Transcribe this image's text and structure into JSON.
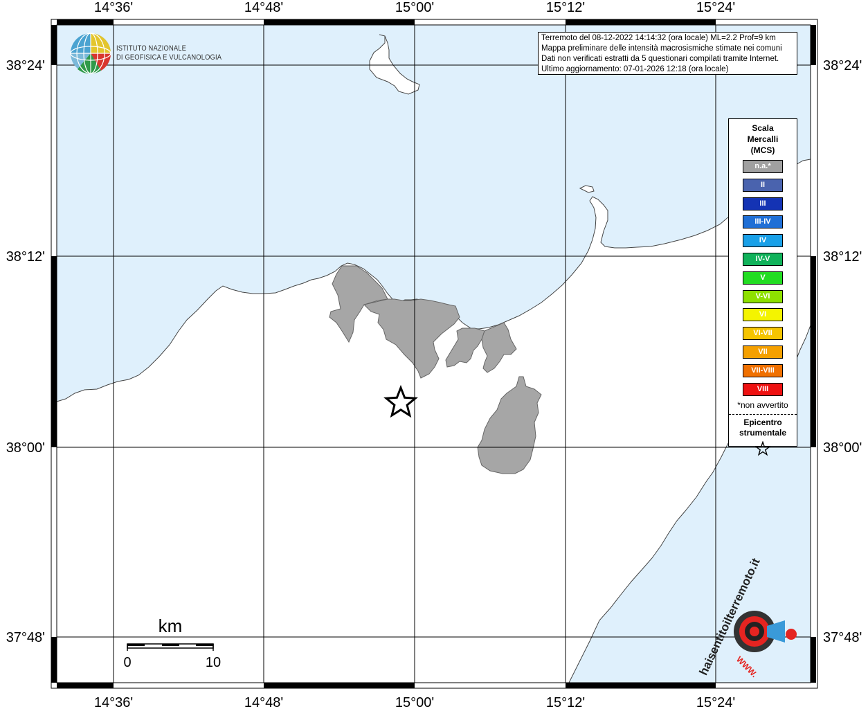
{
  "info": {
    "line1": "Terremoto del 08-12-2022 14:14:32 (ora locale) ML=2.2 Prof=9 km",
    "line2": "Mappa preliminare delle intensità macrosismiche stimate nei comuni",
    "line3": "Dati non verificati estratti da 5 questionari compilati tramite Internet.",
    "line4": "Ultimo aggiornamento: 07-01-2026 12:18 (ora locale)"
  },
  "logo": {
    "line1": "ISTITUTO NAZIONALE",
    "line2": "DI GEOFISICA E VULCANOLOGIA"
  },
  "axes": {
    "lon_labels": [
      "14°36'",
      "14°48'",
      "15°00'",
      "15°12'",
      "15°24'"
    ],
    "lat_labels": [
      "38°24'",
      "38°12'",
      "38°00'",
      "37°48'"
    ]
  },
  "legend": {
    "title1": "Scala",
    "title2": "Mercalli",
    "title3": "(MCS)",
    "items": [
      {
        "label": "n.a.*",
        "color": "#a0a0a0"
      },
      {
        "label": "II",
        "color": "#4a63ae"
      },
      {
        "label": "III",
        "color": "#1433b4"
      },
      {
        "label": "III-IV",
        "color": "#1f6fd6"
      },
      {
        "label": "IV",
        "color": "#19a0e8"
      },
      {
        "label": "IV-V",
        "color": "#10b25a"
      },
      {
        "label": "V",
        "color": "#22dd22"
      },
      {
        "label": "V-VI",
        "color": "#8ee000"
      },
      {
        "label": "VI",
        "color": "#f4f400"
      },
      {
        "label": "VI-VII",
        "color": "#f5c400"
      },
      {
        "label": "VII",
        "color": "#f5a000"
      },
      {
        "label": "VII-VIII",
        "color": "#f07000"
      },
      {
        "label": "VIII",
        "color": "#ee1111"
      }
    ],
    "note": "*non avvertito",
    "epicenter1": "Epicentro",
    "epicenter2": "strumentale"
  },
  "scale": {
    "unit": "km",
    "min": "0",
    "max": "10"
  },
  "hsit": {
    "text": "haisentitoilterremoto.it",
    "url": "WWW."
  },
  "colors": {
    "sea": "#dff0fc",
    "land": "#ffffff",
    "affected": "#a6a6a6"
  }
}
